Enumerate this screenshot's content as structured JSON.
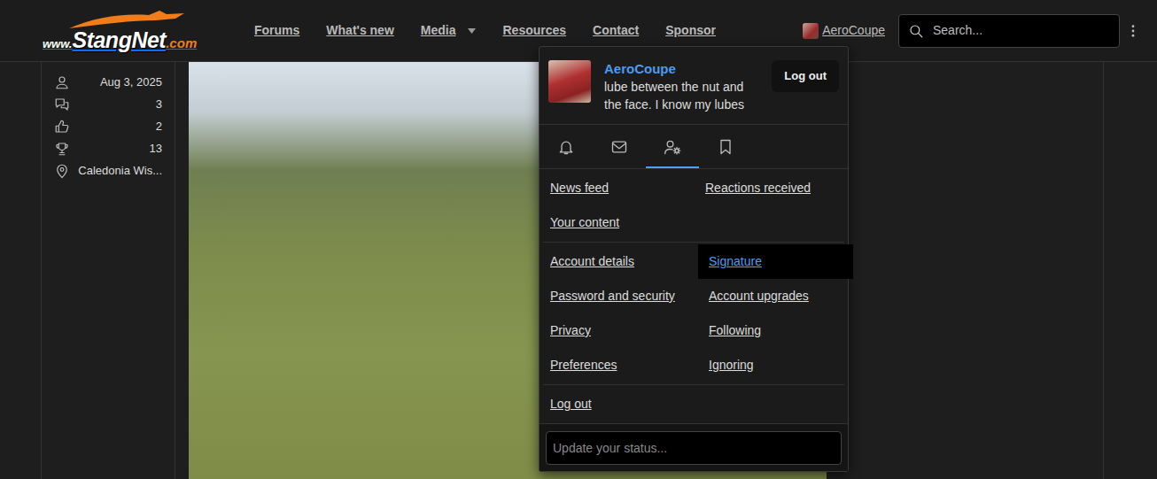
{
  "logo": {
    "prefix": "www.",
    "name": "StangNet",
    "suffix": ".com"
  },
  "nav": [
    {
      "label": "Forums",
      "has_menu": false
    },
    {
      "label": "What's new",
      "has_menu": false
    },
    {
      "label": "Media",
      "has_menu": true
    },
    {
      "label": "Resources",
      "has_menu": false
    },
    {
      "label": "Contact",
      "has_menu": false
    },
    {
      "label": "Sponsor",
      "has_menu": false
    }
  ],
  "user": {
    "name": "AeroCoupe"
  },
  "search": {
    "placeholder": "Search..."
  },
  "profile_stats": [
    {
      "kind": "joined",
      "text": "Aug 3, 2025"
    },
    {
      "kind": "messages",
      "text": "3"
    },
    {
      "kind": "reactions",
      "text": "2"
    },
    {
      "kind": "points",
      "text": "13"
    },
    {
      "kind": "location",
      "text": "Caledonia Wis..."
    }
  ],
  "menu": {
    "name": "AeroCoupe",
    "status": "lube between the nut and the face. I know my lubes",
    "logout_button": "Log out",
    "tabs": [
      {
        "kind": "alerts",
        "selected": false
      },
      {
        "kind": "conversations",
        "selected": false
      },
      {
        "kind": "account",
        "selected": true
      },
      {
        "kind": "bookmarks",
        "selected": false
      }
    ],
    "sections": [
      [
        {
          "label": "News feed",
          "selected": false
        },
        {
          "label": "Reactions received",
          "selected": false
        },
        {
          "label": "Your content",
          "selected": false
        }
      ],
      [
        {
          "label": "Account details",
          "selected": false
        },
        {
          "label": "Signature",
          "selected": true
        },
        {
          "label": "Password and security",
          "selected": false
        },
        {
          "label": "Account upgrades",
          "selected": false
        },
        {
          "label": "Privacy",
          "selected": false
        },
        {
          "label": "Following",
          "selected": false
        },
        {
          "label": "Preferences",
          "selected": false
        },
        {
          "label": "Ignoring",
          "selected": false
        }
      ],
      [
        {
          "label": "Log out",
          "selected": false
        }
      ]
    ],
    "status_placeholder": "Update your status..."
  }
}
